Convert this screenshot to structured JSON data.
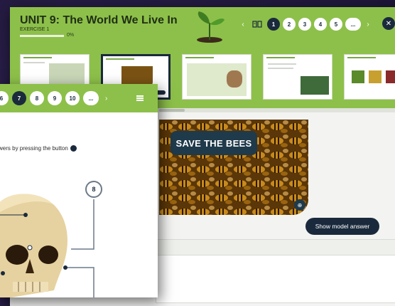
{
  "header": {
    "title": "UNIT 9: The World We Live In",
    "exercise": "EXERCISE 1",
    "progress_percent": 0,
    "progress_label": "0%",
    "pages": [
      "1",
      "2",
      "3",
      "4",
      "5"
    ],
    "active_page": "1",
    "more": "..."
  },
  "banner": {
    "text": "SAVE THE BEES"
  },
  "actions": {
    "show_model_answer": "Show model answer"
  },
  "front": {
    "pages": [
      "6",
      "7",
      "8",
      "9",
      "10"
    ],
    "active_page": "7",
    "more": "...",
    "instruction": "wers by pressing the button",
    "marker": "8"
  },
  "colors": {
    "header_green": "#8dc04a",
    "navy": "#1a2a3c"
  }
}
